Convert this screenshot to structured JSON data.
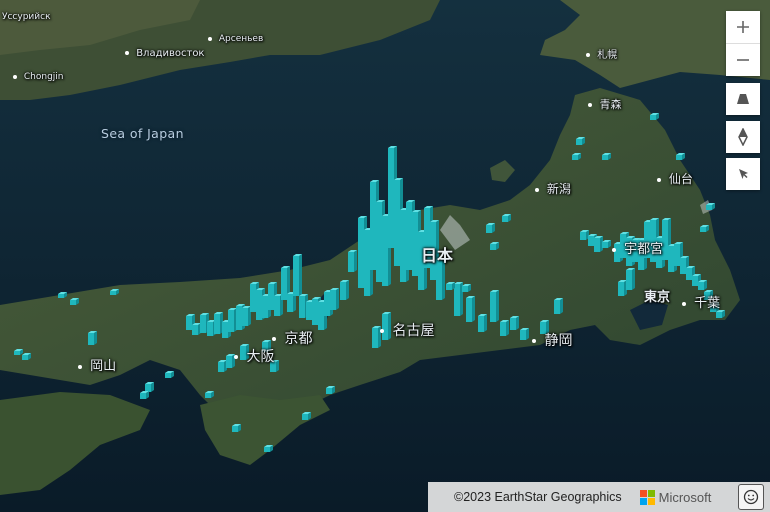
{
  "places": [
    {
      "id": "ussuriysk",
      "text": "Уссурийск",
      "dot": false
    },
    {
      "id": "arseniev",
      "text": "Арсеньев",
      "dot": true
    },
    {
      "id": "vladivostok",
      "text": "Владивосток",
      "dot": true
    },
    {
      "id": "chongjin",
      "text": "Chongjin",
      "dot": true
    },
    {
      "id": "sapporo",
      "text": "札幌",
      "dot": true
    },
    {
      "id": "aomori",
      "text": "青森",
      "dot": true
    },
    {
      "id": "sendai",
      "text": "仙台",
      "dot": true
    },
    {
      "id": "niigata",
      "text": "新潟",
      "dot": true
    },
    {
      "id": "nihon",
      "text": "日本",
      "dot": false
    },
    {
      "id": "utsunomiya",
      "text": "宇都宮",
      "dot": true
    },
    {
      "id": "tokyo",
      "text": "東京",
      "dot": true
    },
    {
      "id": "chiba",
      "text": "千葉",
      "dot": true
    },
    {
      "id": "kyoto",
      "text": "京都",
      "dot": true
    },
    {
      "id": "nagoya",
      "text": "名古屋",
      "dot": true
    },
    {
      "id": "shizuoka",
      "text": "静岡",
      "dot": true
    },
    {
      "id": "osaka",
      "text": "大阪",
      "dot": true
    },
    {
      "id": "okayama",
      "text": "岡山",
      "dot": true
    }
  ],
  "sea_label": "Sea of Japan",
  "controls": {
    "zoom_in": "plus-icon",
    "zoom_out": "minus-icon",
    "pitch": "pitch-icon",
    "compass": "compass-icon",
    "select": "pointer-icon"
  },
  "attribution": {
    "copyright": "©2023 EarthStar Geographics",
    "brand": "Microsoft",
    "feedback_icon": "smiley-icon"
  },
  "colors": {
    "bar": "#1fb7bd",
    "water": "#0d2230",
    "land": "#3b5133"
  }
}
